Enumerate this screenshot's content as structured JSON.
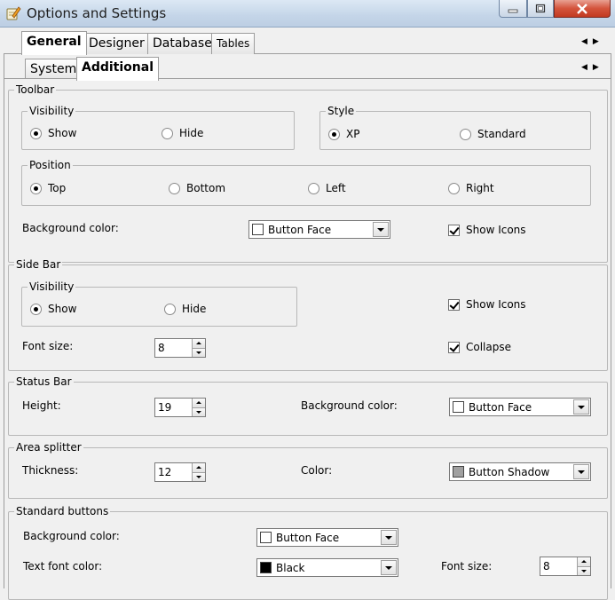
{
  "window": {
    "title": "Options and Settings",
    "icons": {
      "app": "settings-pencil-icon",
      "minimize": "minimize-icon",
      "maximize": "maximize-icon",
      "close": "close-icon"
    }
  },
  "main_tabs": [
    {
      "label": "General",
      "active": true
    },
    {
      "label": "Designer",
      "active": false
    },
    {
      "label": "Database",
      "active": false
    },
    {
      "label": "Tables",
      "active": false
    }
  ],
  "sub_tabs": [
    {
      "label": "System",
      "active": false
    },
    {
      "label": "Additional",
      "active": true
    }
  ],
  "toolbar": {
    "title": "Toolbar",
    "visibility": {
      "title": "Visibility",
      "options": [
        "Show",
        "Hide"
      ],
      "selected": "Show"
    },
    "style": {
      "title": "Style",
      "options": [
        "XP",
        "Standard"
      ],
      "selected": "XP"
    },
    "position": {
      "title": "Position",
      "options": [
        "Top",
        "Bottom",
        "Left",
        "Right"
      ],
      "selected": "Top"
    },
    "background_label": "Background color:",
    "background_value": "Button Face",
    "background_swatch": "#ffffff",
    "show_icons_label": "Show Icons",
    "show_icons": true
  },
  "side_bar": {
    "title": "Side Bar",
    "visibility": {
      "title": "Visibility",
      "options": [
        "Show",
        "Hide"
      ],
      "selected": "Show"
    },
    "show_icons_label": "Show Icons",
    "show_icons": true,
    "font_size_label": "Font size:",
    "font_size": "8",
    "collapse_label": "Collapse",
    "collapse": true
  },
  "status_bar": {
    "title": "Status Bar",
    "height_label": "Height:",
    "height": "19",
    "background_label": "Background color:",
    "background_value": "Button Face",
    "background_swatch": "#ffffff"
  },
  "area_splitter": {
    "title": "Area splitter",
    "thickness_label": "Thickness:",
    "thickness": "12",
    "color_label": "Color:",
    "color_value": "Button Shadow",
    "color_swatch": "#a0a0a0"
  },
  "standard_buttons": {
    "title": "Standard buttons",
    "background_label": "Background color:",
    "background_value": "Button Face",
    "background_swatch": "#ffffff",
    "text_color_label": "Text font color:",
    "text_color_value": "Black",
    "text_color_swatch": "#000000",
    "font_size_label": "Font size:",
    "font_size": "8"
  }
}
